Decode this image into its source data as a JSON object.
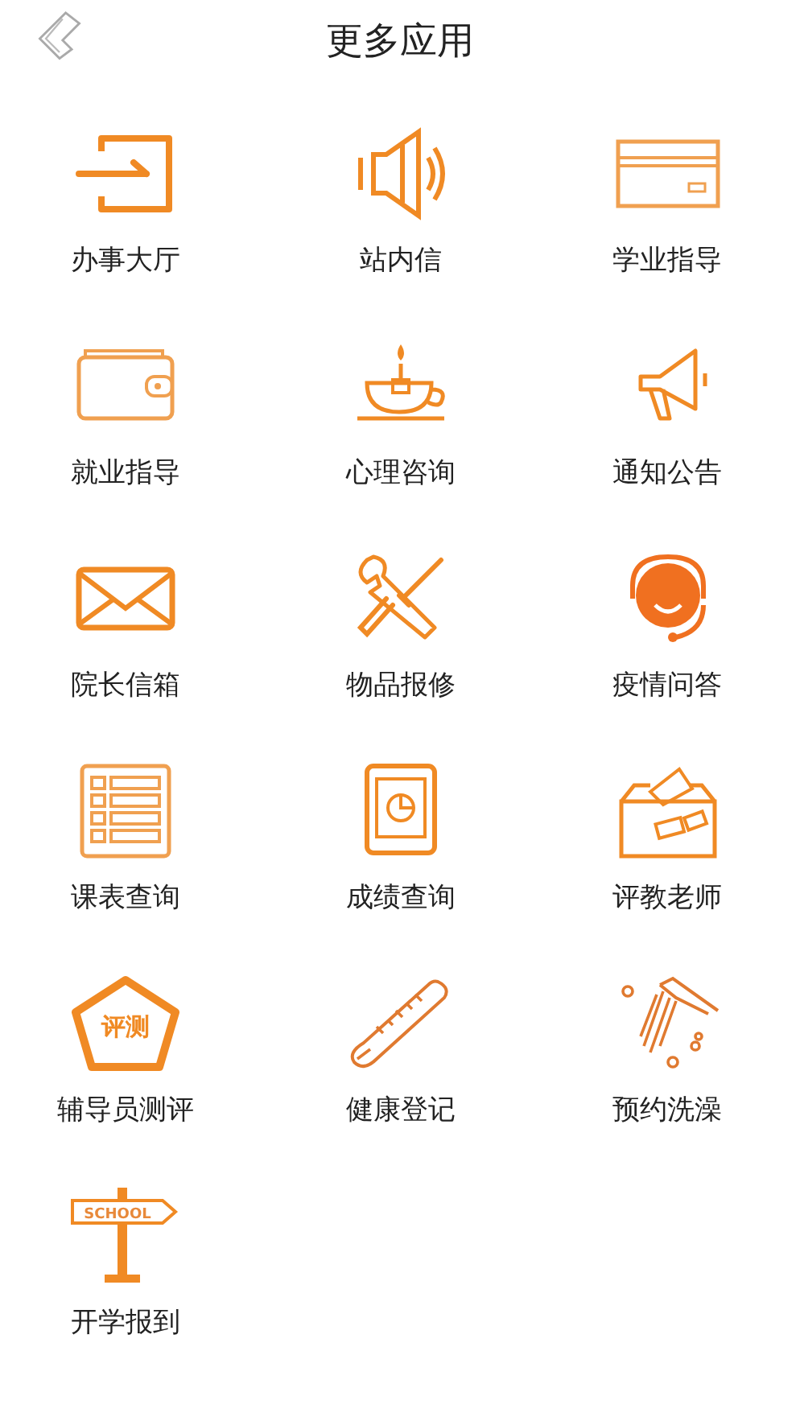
{
  "header": {
    "title": "更多应用"
  },
  "apps": [
    {
      "kind": "exit",
      "label": "办事大厅"
    },
    {
      "kind": "speaker",
      "label": "站内信"
    },
    {
      "kind": "card",
      "label": "学业指导"
    },
    {
      "kind": "wallet",
      "label": "就业指导"
    },
    {
      "kind": "cup",
      "label": "心理咨询"
    },
    {
      "kind": "megaphone",
      "label": "通知公告"
    },
    {
      "kind": "envelope",
      "label": "院长信箱"
    },
    {
      "kind": "tools",
      "label": "物品报修"
    },
    {
      "kind": "headset",
      "label": "疫情问答"
    },
    {
      "kind": "list",
      "label": "课表查询"
    },
    {
      "kind": "tablet",
      "label": "成绩查询"
    },
    {
      "kind": "ballot",
      "label": "评教老师"
    },
    {
      "kind": "badge",
      "label": "辅导员测评",
      "icon_text": "评测"
    },
    {
      "kind": "thermometer",
      "label": "健康登记"
    },
    {
      "kind": "shower",
      "label": "预约洗澡"
    },
    {
      "kind": "signpost",
      "label": "开学报到",
      "icon_text": "SCHOOL"
    }
  ]
}
